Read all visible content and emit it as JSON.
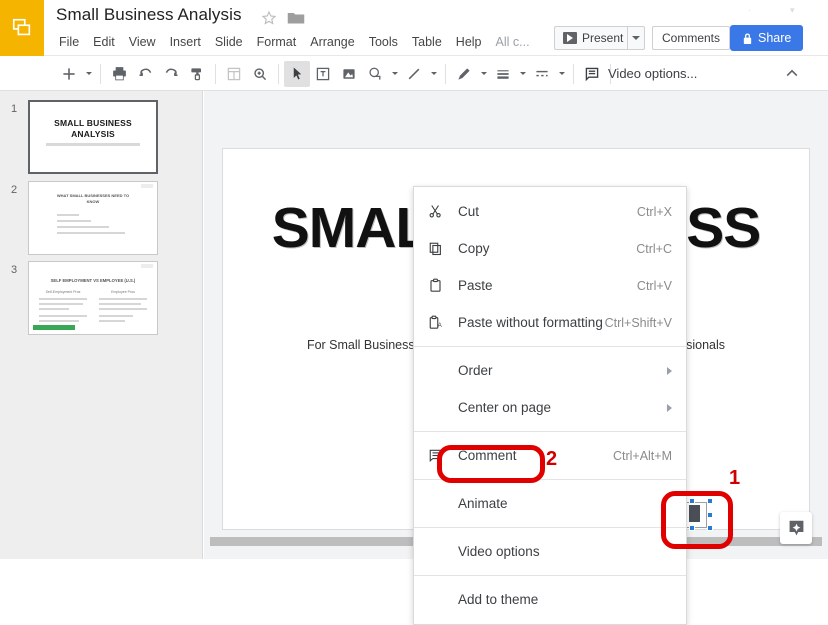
{
  "app": {
    "logo_icon": "slides-logo-icon",
    "title": "Small Business Analysis",
    "star_icon": "star-icon",
    "folder_icon": "folder-icon"
  },
  "menubar": {
    "items": [
      {
        "label": "File",
        "name": "menu-file"
      },
      {
        "label": "Edit",
        "name": "menu-edit"
      },
      {
        "label": "View",
        "name": "menu-view"
      },
      {
        "label": "Insert",
        "name": "menu-insert"
      },
      {
        "label": "Slide",
        "name": "menu-slide"
      },
      {
        "label": "Format",
        "name": "menu-format"
      },
      {
        "label": "Arrange",
        "name": "menu-arrange"
      },
      {
        "label": "Tools",
        "name": "menu-tools"
      },
      {
        "label": "Table",
        "name": "menu-table"
      },
      {
        "label": "Help",
        "name": "menu-help"
      }
    ],
    "all_changes": "All c..."
  },
  "header_actions": {
    "present_label": "Present",
    "present_icon": "present-play-icon",
    "present_dropdown_icon": "chevron-down-icon",
    "comments_label": "Comments",
    "share_label": "Share",
    "share_icon": "lock-icon"
  },
  "toolbar": {
    "new_slide_icon": "plus-icon",
    "new_slide_dropdown_icon": "chevron-down-icon",
    "print_icon": "printer-icon",
    "undo_icon": "undo-arrow-icon",
    "redo_icon": "redo-arrow-icon",
    "paint_format_icon": "paint-format-icon",
    "layout_icon": "layout-icon",
    "zoom_icon": "zoom-in-magnifier-icon",
    "select_icon": "cursor-arrow-icon",
    "textbox_icon": "text-box-icon",
    "image_icon": "image-icon",
    "shape_icon": "shape-icon",
    "shape_dropdown_icon": "chevron-down-icon",
    "line_icon": "line-icon",
    "line_dropdown_icon": "chevron-down-icon",
    "pen_icon": "pen-color-icon",
    "pen_dropdown_icon": "chevron-down-icon",
    "line_weight_icon": "line-weight-icon",
    "line_weight_dropdown_icon": "chevron-down-icon",
    "line_dash_icon": "line-dash-icon",
    "line_dash_dropdown_icon": "chevron-down-icon",
    "speaker_notes_icon": "speaker-notes-icon",
    "video_options_label": "Video options...",
    "collapse_icon": "chevron-up-icon"
  },
  "filmstrip": {
    "slides": [
      {
        "number": "1",
        "selected": true,
        "title": "SMALL BUSINESS ANALYSIS",
        "name": "slide-thumbnail-1"
      },
      {
        "number": "2",
        "selected": false,
        "title": "WHAT SMALL BUSINESSES NEED TO KNOW",
        "name": "slide-thumbnail-2"
      },
      {
        "number": "3",
        "selected": false,
        "title": "SELF EMPLOYMENT VS EMPLOYEE (U.S.)",
        "col_left": "Self-Employment Pros",
        "col_right": "Employee Pros",
        "name": "slide-thumbnail-3"
      }
    ]
  },
  "canvas": {
    "slide_title": "SMALL BUSINESS A",
    "slide_title_line1": "SMALL BUSINESS",
    "slide_title_line2": "A",
    "slide_subtitle_left": "For Small Business",
    "slide_subtitle_right": "sionals",
    "selected_object": "video-object",
    "explore_icon": "explore-icon",
    "hscrollbar": "horizontal-scrollbar"
  },
  "context_menu": {
    "items": [
      {
        "label": "Cut",
        "accel": "Ctrl+X",
        "icon": "scissors-icon",
        "sub": false,
        "name": "context-menu-item-cut"
      },
      {
        "label": "Copy",
        "accel": "Ctrl+C",
        "icon": "copy-icon",
        "sub": false,
        "name": "context-menu-item-copy"
      },
      {
        "label": "Paste",
        "accel": "Ctrl+V",
        "icon": "clipboard-icon",
        "sub": false,
        "name": "context-menu-item-paste"
      },
      {
        "label": "Paste without formatting",
        "accel": "Ctrl+Shift+V",
        "icon": "clipboard-a-icon",
        "sub": false,
        "name": "context-menu-item-paste-without-formatting"
      },
      {
        "separator": true
      },
      {
        "label": "Order",
        "accel": "",
        "icon": "",
        "sub": true,
        "name": "context-menu-item-order"
      },
      {
        "label": "Center on page",
        "accel": "",
        "icon": "",
        "sub": true,
        "name": "context-menu-item-center-on-page"
      },
      {
        "separator": true
      },
      {
        "label": "Comment",
        "accel": "Ctrl+Alt+M",
        "icon": "comment-icon",
        "sub": false,
        "name": "context-menu-item-comment"
      },
      {
        "separator": true
      },
      {
        "label": "Animate",
        "accel": "",
        "icon": "",
        "sub": false,
        "name": "context-menu-item-animate"
      },
      {
        "separator": true
      },
      {
        "label": "Video options",
        "accel": "",
        "icon": "",
        "sub": false,
        "highlighted": true,
        "name": "context-menu-item-video-options"
      },
      {
        "separator": true
      },
      {
        "label": "Add to theme",
        "accel": "",
        "icon": "",
        "sub": false,
        "name": "context-menu-item-add-to-theme"
      }
    ]
  },
  "annotations": {
    "color": "#e00000",
    "marker_1": "1",
    "marker_2": "2"
  }
}
